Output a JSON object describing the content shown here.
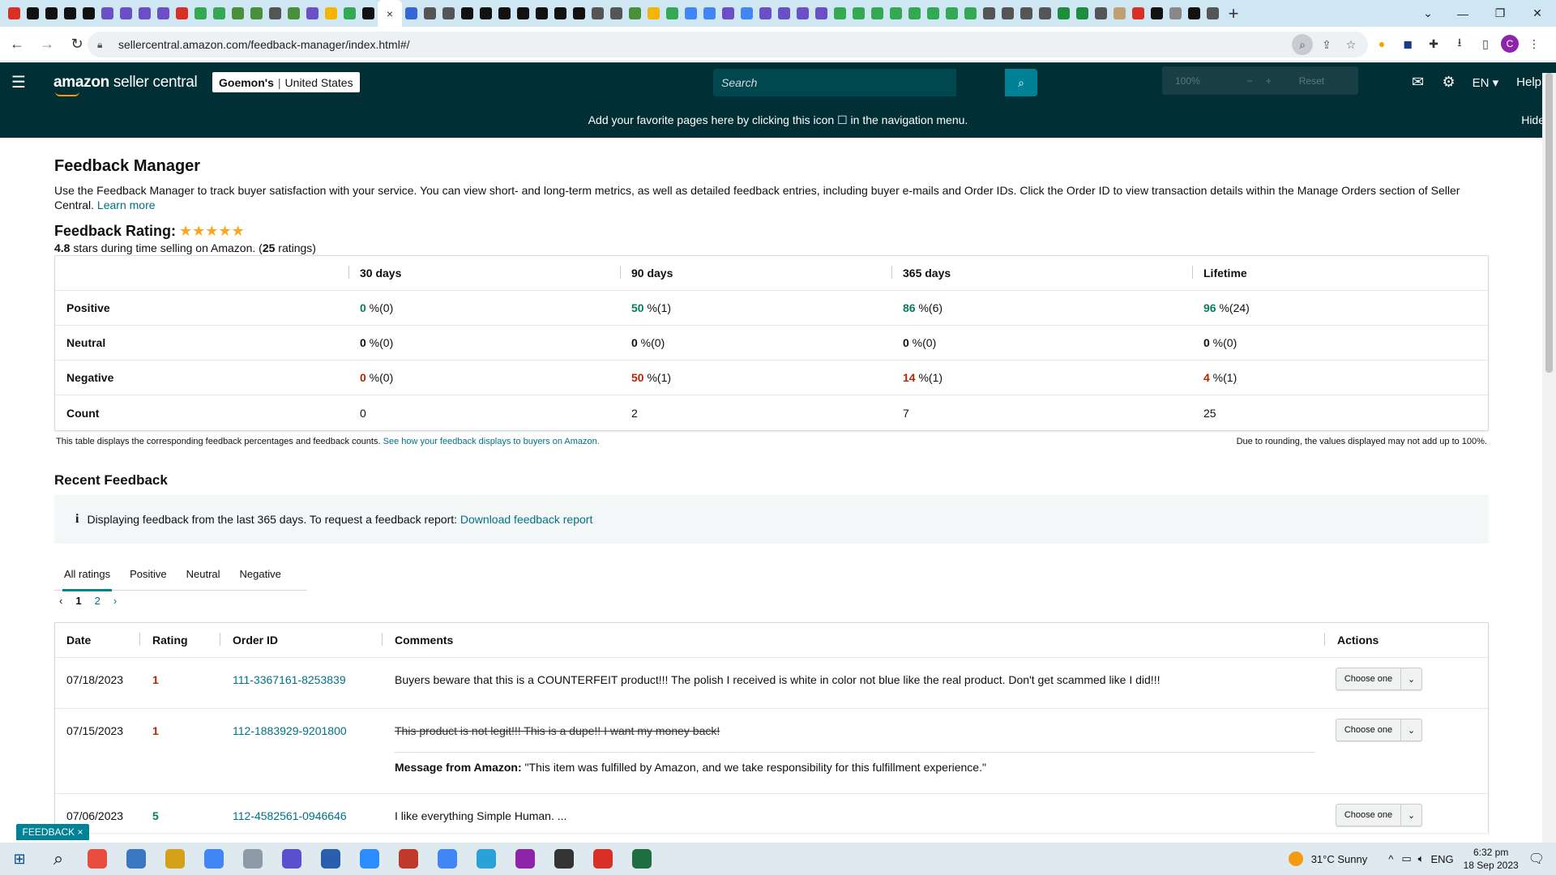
{
  "browser": {
    "url": "sellercentral.amazon.com/feedback-manager/index.html#/",
    "tab_favicons": [
      "#d93025",
      "#111",
      "#111",
      "#111",
      "#111",
      "#6a4fc7",
      "#6a4fc7",
      "#6a4fc7",
      "#6a4fc7",
      "#d93025",
      "#34a853",
      "#34a853",
      "#4a8f3a",
      "#4a8f3a",
      "#555",
      "#4a8f3a",
      "#6a4fc7",
      "#f4b400",
      "#34a853",
      "#111"
    ],
    "tab_favicons_2": [
      "#3367d6",
      "#555",
      "#555",
      "#111",
      "#111",
      "#111",
      "#111",
      "#111",
      "#111",
      "#111",
      "#555",
      "#555",
      "#4a8f3a",
      "#f4b400",
      "#34a853",
      "#4285f4",
      "#4285f4",
      "#6a4fc7",
      "#4285f4",
      "#6a4fc7",
      "#6a4fc7",
      "#6a4fc7",
      "#6a4fc7",
      "#34a853",
      "#34a853",
      "#34a853",
      "#34a853",
      "#34a853",
      "#34a853",
      "#34a853",
      "#34a853",
      "#555",
      "#555",
      "#555",
      "#555",
      "#1e8e3e",
      "#1e8e3e",
      "#555",
      "#c0a070",
      "#d93025",
      "#111",
      "#888",
      "#111",
      "#555"
    ],
    "active_tab_close": "×",
    "new_tab": "+"
  },
  "header": {
    "logo_bold": "amazon",
    "logo_text": " seller central",
    "account_name": "Goemon's",
    "account_region": "United States",
    "search_placeholder": "Search",
    "zoom_text": "100%",
    "zoom_reset": "Reset",
    "lang": "EN",
    "help": "Help"
  },
  "banner": {
    "text": "Add your favorite pages here by clicking this icon ☐ in the navigation menu.",
    "hide": "Hide"
  },
  "page": {
    "title": "Feedback Manager",
    "intro": "Use the Feedback Manager to track buyer satisfaction with your service. You can view short- and long-term metrics, as well as detailed feedback entries, including buyer e-mails and Order IDs. Click the Order ID to view transaction details within the Manage Orders section of Seller Central.",
    "learn_more": "Learn more",
    "rating_label": "Feedback Rating:",
    "stars": "★★★★★",
    "rating_value": "4.8",
    "rating_mid": " stars during time selling on Amazon. (",
    "rating_count": "25",
    "rating_end": " ratings)"
  },
  "metrics": {
    "columns": [
      "",
      "30 days",
      "90 days",
      "365 days",
      "Lifetime"
    ],
    "rows": [
      {
        "label": "Positive",
        "cells": [
          {
            "v": "0",
            "s": " %(0)"
          },
          {
            "v": "50",
            "s": " %(1)"
          },
          {
            "v": "86",
            "s": " %(6)"
          },
          {
            "v": "96",
            "s": " %(24)"
          }
        ]
      },
      {
        "label": "Neutral",
        "cells": [
          {
            "v": "0",
            "s": " %(0)"
          },
          {
            "v": "0",
            "s": " %(0)"
          },
          {
            "v": "0",
            "s": " %(0)"
          },
          {
            "v": "0",
            "s": " %(0)"
          }
        ]
      },
      {
        "label": "Negative",
        "cells": [
          {
            "v": "0",
            "s": " %(0)"
          },
          {
            "v": "50",
            "s": " %(1)"
          },
          {
            "v": "14",
            "s": " %(1)"
          },
          {
            "v": "4",
            "s": " %(1)"
          }
        ]
      },
      {
        "label": "Count",
        "cells": [
          {
            "v": "0",
            "s": ""
          },
          {
            "v": "2",
            "s": ""
          },
          {
            "v": "7",
            "s": ""
          },
          {
            "v": "25",
            "s": ""
          }
        ]
      }
    ],
    "note": "This table displays the corresponding feedback percentages and feedback counts.",
    "note_link": "See how your feedback displays to buyers on Amazon.",
    "note_right": "Due to rounding, the values displayed may not add up to 100%."
  },
  "recent": {
    "title": "Recent Feedback",
    "info": "Displaying feedback from the last 365 days. To request a feedback report:",
    "info_link": "Download feedback report",
    "tabs": [
      "All ratings",
      "Positive",
      "Neutral",
      "Negative"
    ],
    "pager": {
      "prev": "‹",
      "pages": [
        "1",
        "2"
      ],
      "next": "›"
    },
    "columns": [
      "Date",
      "Rating",
      "Order ID",
      "Comments",
      "Actions"
    ],
    "rows": [
      {
        "date": "07/18/2023",
        "rating": "1",
        "order": "111-3367161-8253839",
        "comment": "Buyers beware that this is a COUNTERFEIT product!!! The polish I received is white in color not blue like the real product. Don't get scammed like I did!!!",
        "action": "Choose one"
      },
      {
        "date": "07/15/2023",
        "rating": "1",
        "order": "112-1883929-9201800",
        "comment": "This product is not legit!!! This is a dupe!! I want my money back!",
        "msg_label": "Message from Amazon:",
        "msg": " \"This item was fulfilled by Amazon, and we take responsibility for this fulfillment experience.\"",
        "action": "Choose one"
      },
      {
        "date": "07/06/2023",
        "rating": "5",
        "order": "112-4582561-0946646",
        "comment": "I like everything Simple Human. ...",
        "action": "Choose one"
      }
    ]
  },
  "feedback_tab": "FEEDBACK ×",
  "taskbar": {
    "weather": "31°C  Sunny",
    "lang": "ENG",
    "time": "6:32 pm",
    "date": "18 Sep 2023",
    "icons": [
      "#e74c3c",
      "#3a78c2",
      "#d4a017",
      "#4285f4",
      "#8e9aa6",
      "#5a4fcf",
      "#2a5fb0",
      "#2d8cff",
      "#c0392b",
      "#4285f4",
      "#2aa1d8",
      "#8e24aa",
      "#333",
      "#d93025",
      "#1d6f42"
    ]
  }
}
